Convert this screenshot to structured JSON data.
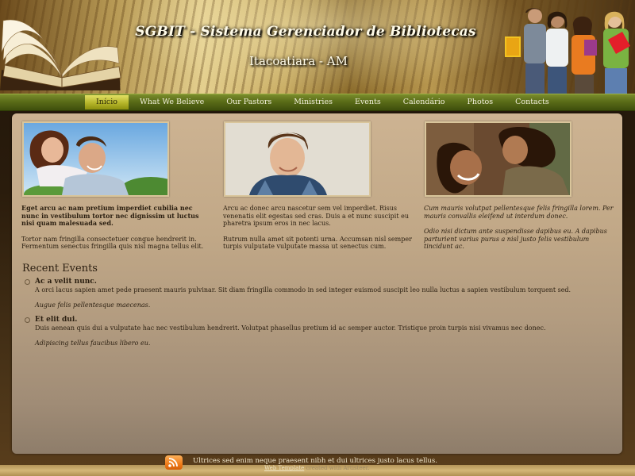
{
  "header": {
    "title": "SGBIT - Sistema Gerenciador de Bibliotecas",
    "subtitle": "Itacoatiara - AM"
  },
  "nav": {
    "items": [
      {
        "label": "Início",
        "active": true
      },
      {
        "label": "What We Believe",
        "active": false
      },
      {
        "label": "Our Pastors",
        "active": false
      },
      {
        "label": "Ministries",
        "active": false
      },
      {
        "label": "Events",
        "active": false
      },
      {
        "label": "Calendário",
        "active": false
      },
      {
        "label": "Photos",
        "active": false
      },
      {
        "label": "Contacts",
        "active": false
      }
    ]
  },
  "columns": [
    {
      "p1": "Eget arcu ac nam pretium imperdiet cubilia nec nunc in vestibulum tortor nec dignissim ut luctus nisi quam malesuada sed.",
      "p2": "Tortor nam fringilla consectetuer congue hendrerit in. Fermentum senectus fringilla quis nisl magna tellus elit."
    },
    {
      "p1": "Arcu ac donec arcu nascetur sem vel imperdiet. Risus venenatis elit egestas sed cras. Duis a et nunc suscipit eu pharetra ipsum eros in nec lacus.",
      "p2": "Rutrum nulla amet sit potenti urna. Accumsan nisl semper turpis vulputate vulputate massa ut senectus cum."
    },
    {
      "p1": "Cum mauris volutpat pellentesque felis fringilla lorem. Per mauris convallis eleifend ut interdum donec.",
      "p2": "Odio nisi dictum ante suspendisse dapibus eu. A dapibus parturient varius purus a nisl justo felis vestibulum tincidunt ac."
    }
  ],
  "recent_events": {
    "title": "Recent Events",
    "items": [
      {
        "title": "Ac a velit nunc.",
        "body": "A orci lacus sapien amet pede praesent mauris pulvinar. Sit diam fringilla commodo in sed integer euismod suscipit leo nulla luctus a sapien vestibulum torquent sed.",
        "note": "Augue felis pellentesque maecenas."
      },
      {
        "title": "Et elit dui.",
        "body": "Duis aenean quis dui a vulputate hac nec vestibulum hendrerit. Volutpat phasellus pretium id ac semper auctor. Tristique proin turpis nisi vivamus nec donec.",
        "note": "Adipiscing tellus faucibus libero eu."
      }
    ]
  },
  "footer": {
    "text": "Ultrices sed enim neque praesent nibh et dui ultrices justo lacus tellus.",
    "credit_link": "Web Template",
    "credit_rest": "created with Artisteer."
  },
  "colors": {
    "nav_active": "#c8c83a",
    "nav_bar": "#5a6c18",
    "panel": "#c1a887",
    "rss": "#f07d1a"
  },
  "icons": {
    "rss": "rss-icon"
  }
}
